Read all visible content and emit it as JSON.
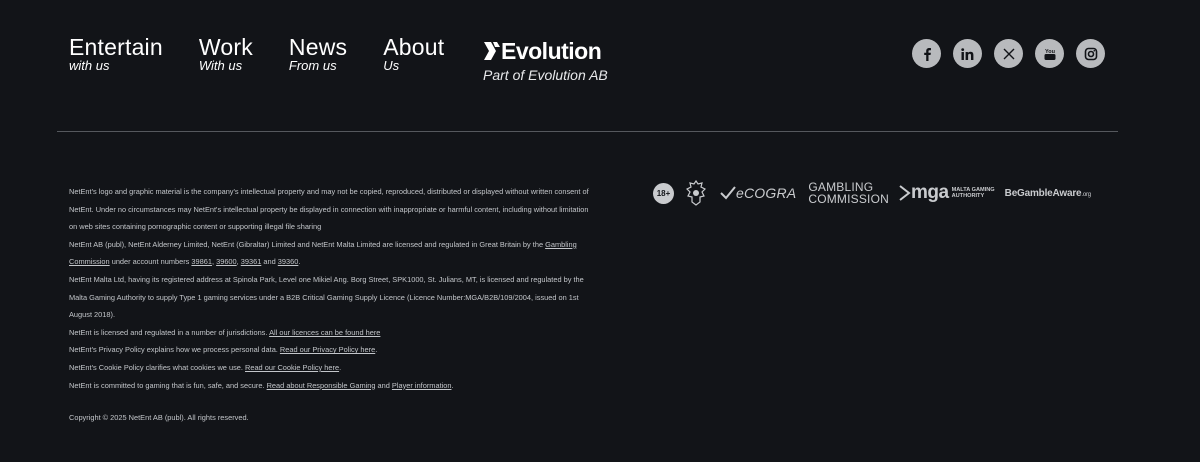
{
  "nav": [
    {
      "title": "Entertain",
      "sub": "with us"
    },
    {
      "title": "Work",
      "sub": "With us"
    },
    {
      "title": "News",
      "sub": "From us"
    },
    {
      "title": "About",
      "sub": "Us"
    }
  ],
  "brand": {
    "name": "Evolution",
    "sub": "Part of Evolution AB"
  },
  "social": [
    {
      "name": "facebook-icon",
      "glyph": "f"
    },
    {
      "name": "linkedin-icon",
      "glyph": "in"
    },
    {
      "name": "x-icon",
      "glyph": "𝕏"
    },
    {
      "name": "youtube-icon",
      "glyph": "You"
    },
    {
      "name": "instagram-icon",
      "glyph": ""
    }
  ],
  "legal": {
    "p1": "NetEnt's logo and graphic material is the company's intellectual property and may not be copied, reproduced, distributed or displayed without written consent of NetEnt. Under no circumstances may NetEnt's intellectual property be displayed in connection with inappropriate or harmful content, including without limitation on web sites containing pornographic content or supporting illegal file sharing",
    "p2_a": "NetEnt AB (publ), NetEnt Alderney Limited, NetEnt (Gibraltar) Limited and NetEnt Malta Limited are licensed and regulated in Great Britain by the ",
    "p2_link": "Gambling Commission",
    "p2_b": " under account numbers ",
    "acc1": "39861",
    "sep1": ", ",
    "acc2": "39600",
    "sep2": ", ",
    "acc3": "39361",
    "and": " and ",
    "acc4": "39360",
    "end": ".",
    "p3": "NetEnt Malta Ltd, having its registered address at Spinola Park, Level one Mikiel Ang. Borg Street, SPK1000, St. Julians, MT, is licensed and regulated by the Malta Gaming Authority to supply Type 1 gaming services under a B2B Critical Gaming Supply Licence (Licence Number:MGA/B2B/109/2004, issued on 1st August 2018).",
    "p4_a": "NetEnt is licensed and regulated in a number of jurisdictions. ",
    "p4_link": "All our licences can be found here",
    "p5_a": "NetEnt's Privacy Policy explains how we process personal data. ",
    "p5_link": "Read our Privacy Policy here",
    "p5_end": ".",
    "p6_a": "NetEnt's Cookie Policy clarifies what cookies we use. ",
    "p6_link": "Read our Cookie Policy here",
    "p6_end": ".",
    "p7_a": "NetEnt is committed to gaming that is fun, safe, and secure. ",
    "p7_link1": "Read about Responsible Gaming",
    "p7_and": " and ",
    "p7_link2": "Player information",
    "p7_end": "."
  },
  "copyright": "Copyright © 2025 NetEnt AB (publ). All rights reserved.",
  "logos": {
    "age": "18+",
    "ecogra": "eCOGRA",
    "gc_line1": "GAMBLING",
    "gc_line2": "COMMISSION",
    "mga": "mga",
    "mga_sub1": "MALTA GAMING",
    "mga_sub2": "AUTHORITY",
    "bga": "BeGambleAware",
    "bga_org": ".org"
  },
  "colors": {
    "background": "#121418",
    "text": "#c3c6ca",
    "icon_bg": "#b8babd"
  }
}
